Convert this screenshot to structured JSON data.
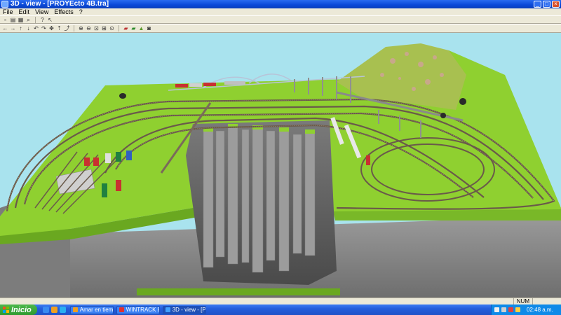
{
  "window": {
    "title": "3D - view - [PROYEcto 4B.tra]",
    "buttons": {
      "minimize": "_",
      "maximize": "□",
      "close": "×"
    }
  },
  "menu": [
    "File",
    "Edit",
    "View",
    "Effects",
    "?"
  ],
  "toolbar1": {
    "icons": [
      "new-file-icon",
      "print-icon",
      "print-preview-icon",
      "zoom-icon",
      "help-icon",
      "help-pointer-icon"
    ]
  },
  "toolbar2": {
    "icons": [
      "arrow-left-icon",
      "arrow-right-icon",
      "arrow-up-icon",
      "arrow-down-icon",
      "rotate-left-icon",
      "rotate-right-icon",
      "pan-icon",
      "walk-icon",
      "fly-icon",
      "zoom-in-icon",
      "zoom-out-icon",
      "zoom-window-icon",
      "zoom-all-icon",
      "zoom-fit-icon",
      "locomotive-icon",
      "train-icon",
      "terrain-icon",
      "camera-icon"
    ]
  },
  "status": {
    "num": "NUM"
  },
  "taskbar": {
    "start_label": "Inicio",
    "tasks": [
      {
        "label": "Amar en tiem...",
        "active": false,
        "icon_color": "#f0a020"
      },
      {
        "label": "WINTRACK 8....",
        "active": false,
        "icon_color": "#e03030"
      },
      {
        "label": "3D - view - [P...",
        "active": true,
        "icon_color": "#40a0ff"
      }
    ],
    "clock": "02:48 a.m."
  },
  "colors": {
    "sky": "#a9e3ee",
    "grass": "#8fd030",
    "cliff": "#8a8a8a",
    "titlebar": "#0a48d8"
  }
}
